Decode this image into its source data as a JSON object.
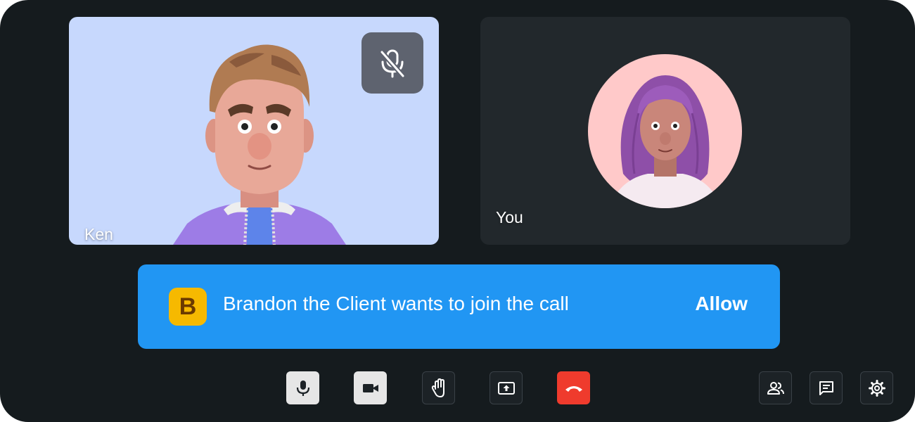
{
  "tiles": [
    {
      "name": "Ken",
      "muted": true,
      "background": "#c7d8fd",
      "icon": "mic-off-icon"
    },
    {
      "name": "You",
      "background": "#22282c"
    }
  ],
  "join_request": {
    "initial": "B",
    "message": "Brandon the Client wants to join the call",
    "allow_label": "Allow",
    "background": "#2196f3",
    "avatar_color": "#f6b900"
  },
  "controls": {
    "center": [
      {
        "icon": "microphone-icon",
        "name": "mic-button"
      },
      {
        "icon": "camera-icon",
        "name": "camera-button"
      },
      {
        "icon": "raise-hand-icon",
        "name": "raise-hand-button"
      },
      {
        "icon": "share-screen-icon",
        "name": "share-screen-button"
      },
      {
        "icon": "end-call-icon",
        "name": "end-call-button",
        "color": "#ef3b2d"
      }
    ],
    "right": [
      {
        "icon": "participants-icon",
        "name": "participants-button"
      },
      {
        "icon": "chat-icon",
        "name": "chat-button"
      },
      {
        "icon": "settings-icon",
        "name": "settings-button"
      }
    ]
  }
}
